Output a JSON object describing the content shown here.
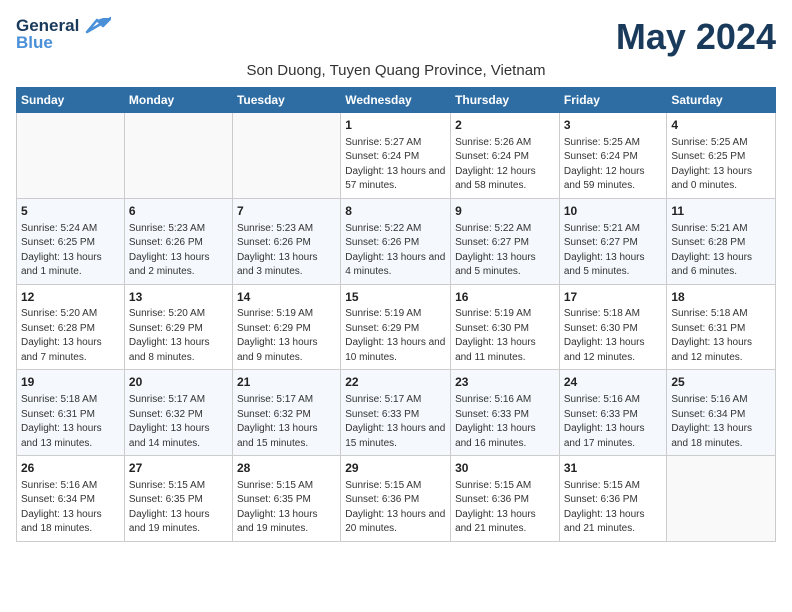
{
  "logo": {
    "line1": "General",
    "line2": "Blue"
  },
  "title": "May 2024",
  "subtitle": "Son Duong, Tuyen Quang Province, Vietnam",
  "weekdays": [
    "Sunday",
    "Monday",
    "Tuesday",
    "Wednesday",
    "Thursday",
    "Friday",
    "Saturday"
  ],
  "weeks": [
    [
      {
        "day": "",
        "info": ""
      },
      {
        "day": "",
        "info": ""
      },
      {
        "day": "",
        "info": ""
      },
      {
        "day": "1",
        "info": "Sunrise: 5:27 AM\nSunset: 6:24 PM\nDaylight: 13 hours and 57 minutes."
      },
      {
        "day": "2",
        "info": "Sunrise: 5:26 AM\nSunset: 6:24 PM\nDaylight: 12 hours and 58 minutes."
      },
      {
        "day": "3",
        "info": "Sunrise: 5:25 AM\nSunset: 6:24 PM\nDaylight: 12 hours and 59 minutes."
      },
      {
        "day": "4",
        "info": "Sunrise: 5:25 AM\nSunset: 6:25 PM\nDaylight: 13 hours and 0 minutes."
      }
    ],
    [
      {
        "day": "5",
        "info": "Sunrise: 5:24 AM\nSunset: 6:25 PM\nDaylight: 13 hours and 1 minute."
      },
      {
        "day": "6",
        "info": "Sunrise: 5:23 AM\nSunset: 6:26 PM\nDaylight: 13 hours and 2 minutes."
      },
      {
        "day": "7",
        "info": "Sunrise: 5:23 AM\nSunset: 6:26 PM\nDaylight: 13 hours and 3 minutes."
      },
      {
        "day": "8",
        "info": "Sunrise: 5:22 AM\nSunset: 6:26 PM\nDaylight: 13 hours and 4 minutes."
      },
      {
        "day": "9",
        "info": "Sunrise: 5:22 AM\nSunset: 6:27 PM\nDaylight: 13 hours and 5 minutes."
      },
      {
        "day": "10",
        "info": "Sunrise: 5:21 AM\nSunset: 6:27 PM\nDaylight: 13 hours and 5 minutes."
      },
      {
        "day": "11",
        "info": "Sunrise: 5:21 AM\nSunset: 6:28 PM\nDaylight: 13 hours and 6 minutes."
      }
    ],
    [
      {
        "day": "12",
        "info": "Sunrise: 5:20 AM\nSunset: 6:28 PM\nDaylight: 13 hours and 7 minutes."
      },
      {
        "day": "13",
        "info": "Sunrise: 5:20 AM\nSunset: 6:29 PM\nDaylight: 13 hours and 8 minutes."
      },
      {
        "day": "14",
        "info": "Sunrise: 5:19 AM\nSunset: 6:29 PM\nDaylight: 13 hours and 9 minutes."
      },
      {
        "day": "15",
        "info": "Sunrise: 5:19 AM\nSunset: 6:29 PM\nDaylight: 13 hours and 10 minutes."
      },
      {
        "day": "16",
        "info": "Sunrise: 5:19 AM\nSunset: 6:30 PM\nDaylight: 13 hours and 11 minutes."
      },
      {
        "day": "17",
        "info": "Sunrise: 5:18 AM\nSunset: 6:30 PM\nDaylight: 13 hours and 12 minutes."
      },
      {
        "day": "18",
        "info": "Sunrise: 5:18 AM\nSunset: 6:31 PM\nDaylight: 13 hours and 12 minutes."
      }
    ],
    [
      {
        "day": "19",
        "info": "Sunrise: 5:18 AM\nSunset: 6:31 PM\nDaylight: 13 hours and 13 minutes."
      },
      {
        "day": "20",
        "info": "Sunrise: 5:17 AM\nSunset: 6:32 PM\nDaylight: 13 hours and 14 minutes."
      },
      {
        "day": "21",
        "info": "Sunrise: 5:17 AM\nSunset: 6:32 PM\nDaylight: 13 hours and 15 minutes."
      },
      {
        "day": "22",
        "info": "Sunrise: 5:17 AM\nSunset: 6:33 PM\nDaylight: 13 hours and 15 minutes."
      },
      {
        "day": "23",
        "info": "Sunrise: 5:16 AM\nSunset: 6:33 PM\nDaylight: 13 hours and 16 minutes."
      },
      {
        "day": "24",
        "info": "Sunrise: 5:16 AM\nSunset: 6:33 PM\nDaylight: 13 hours and 17 minutes."
      },
      {
        "day": "25",
        "info": "Sunrise: 5:16 AM\nSunset: 6:34 PM\nDaylight: 13 hours and 18 minutes."
      }
    ],
    [
      {
        "day": "26",
        "info": "Sunrise: 5:16 AM\nSunset: 6:34 PM\nDaylight: 13 hours and 18 minutes."
      },
      {
        "day": "27",
        "info": "Sunrise: 5:15 AM\nSunset: 6:35 PM\nDaylight: 13 hours and 19 minutes."
      },
      {
        "day": "28",
        "info": "Sunrise: 5:15 AM\nSunset: 6:35 PM\nDaylight: 13 hours and 19 minutes."
      },
      {
        "day": "29",
        "info": "Sunrise: 5:15 AM\nSunset: 6:36 PM\nDaylight: 13 hours and 20 minutes."
      },
      {
        "day": "30",
        "info": "Sunrise: 5:15 AM\nSunset: 6:36 PM\nDaylight: 13 hours and 21 minutes."
      },
      {
        "day": "31",
        "info": "Sunrise: 5:15 AM\nSunset: 6:36 PM\nDaylight: 13 hours and 21 minutes."
      },
      {
        "day": "",
        "info": ""
      }
    ]
  ]
}
